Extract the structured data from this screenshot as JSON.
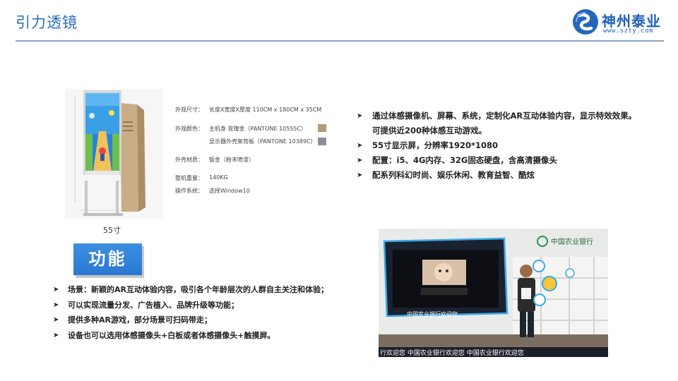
{
  "header": {
    "title": "引力透镜",
    "logo_text": "神州泰业",
    "logo_url": "www.szty.com"
  },
  "product": {
    "caption": "55寸",
    "specs": [
      {
        "label": "外观尺寸：",
        "value": "长度X宽度X厚度   110CM x 180CM x 35CM"
      },
      {
        "label": "外观颜色：",
        "value": "主机身      玫瑰金（PANTONE 10555C）"
      },
      {
        "label": "",
        "value": "显示器外壳架背板（PANTONE 10389C）"
      },
      {
        "label": "外壳材质：",
        "value": "钣金（粉末喷漆）"
      },
      {
        "label": "整机重量：",
        "value": "140KG"
      },
      {
        "label": "操作系统：",
        "value": "选择Window10"
      }
    ],
    "colors": {
      "rose_gold": "#b39a7a",
      "gray": "#8a9096"
    }
  },
  "features": {
    "right_bullets": [
      "通过体感摄像机、屏幕、系统，定制化AR互动体验内容，显示特效效果。可提供近200种体感互动游戏。",
      "55寸显示屏，分辨率1920*1080",
      "配置：i5、4G内存、32G固态硬盘，含高清摄像头",
      "配系列科幻时尚、娱乐休闲、教育益智、酷炫"
    ]
  },
  "function": {
    "badge": "功能",
    "bullets": [
      "场景：新颖的AR互动体验内容，吸引各个年龄层次的人群自主关注和体验；",
      "可以实现流量分发、广告植入、品牌升级等功能；",
      "提供多种AR游戏，部分场景可扫码带走；",
      "设备也可以选用体感摄像头+白板或者体感摄像头+触摸屏。"
    ]
  },
  "photo": {
    "bank_name": "中国农业银行",
    "banner_text": "中国农业银行欢迎您",
    "ticker": "行欢迎您  中国农业银行欢迎您  中国农业银行欢迎您"
  },
  "icon_bullet": "➤",
  "accent": "#2a6cc0"
}
